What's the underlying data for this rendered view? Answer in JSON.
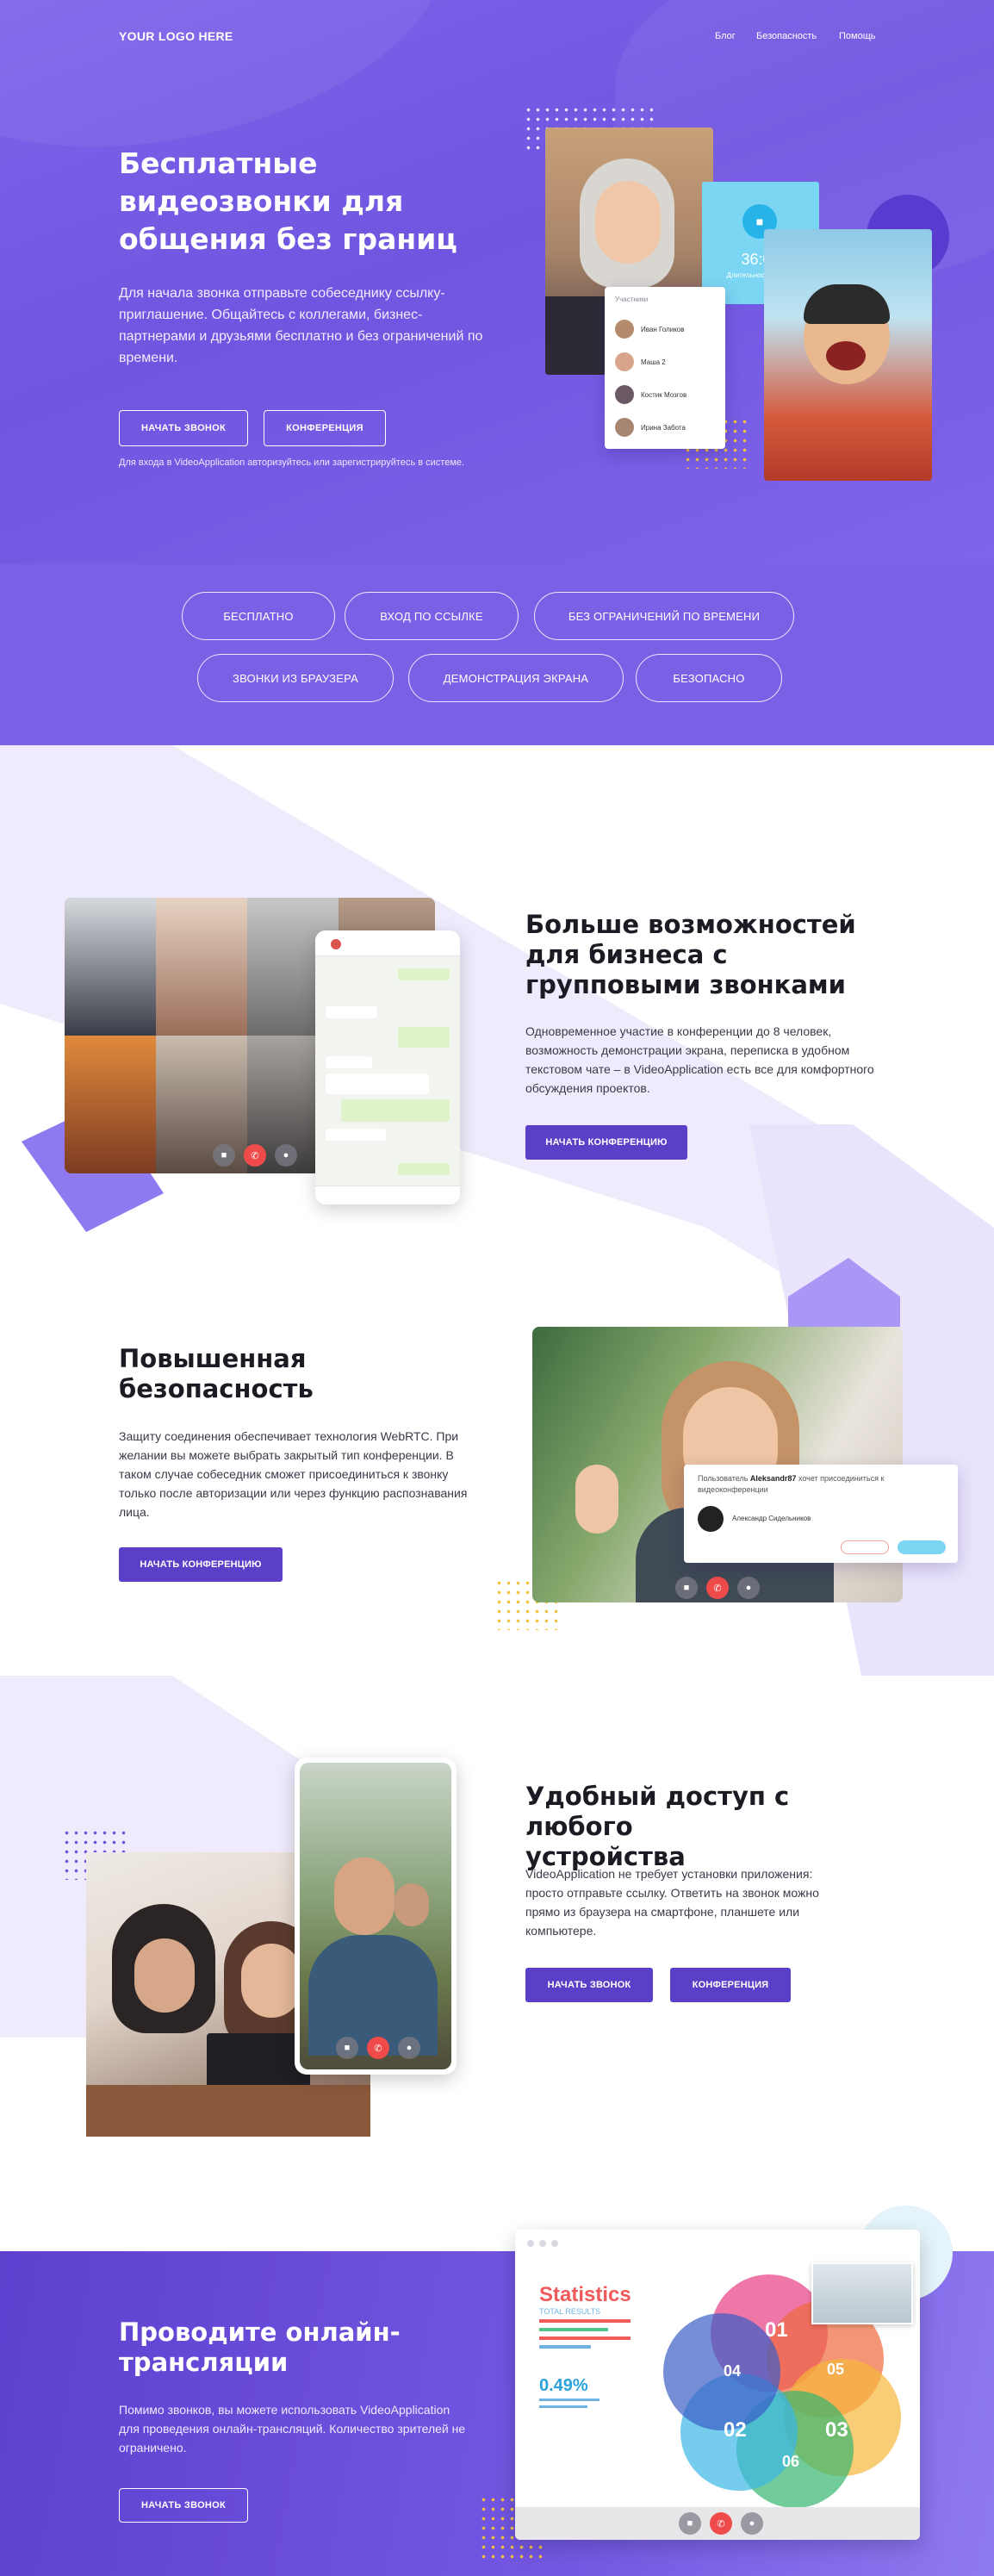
{
  "header": {
    "logo": "YOUR LOGO HERE",
    "nav": [
      "Блог",
      "Безопасность",
      "Помощь"
    ]
  },
  "hero": {
    "title": "Бесплатные видеозвонки для общения без границ",
    "lead": "Для начала звонка отправьте собеседнику ссылку-приглашение. Общайтесь с коллегами, бизнес-партнерами и друзьями бесплатно и без ограничений по времени.",
    "btn_call": "НАЧАТЬ ЗВОНОК",
    "btn_conf": "КОНФЕРЕНЦИЯ",
    "note": "Для входа в VideoApplication авторизуйтесь или зарегистрируйтесь в системе.",
    "timer": "36:05",
    "timer_label": "Длительность звонка",
    "participants_title": "Участники",
    "participants": [
      "Иван Голиков",
      "Маша 2",
      "Костик Мозгов",
      "Ирина Забота"
    ]
  },
  "features": [
    "БЕСПЛАТНО",
    "ВХОД ПО ССЫЛКЕ",
    "БЕЗ ОГРАНИЧЕНИЙ ПО ВРЕМЕНИ",
    "ЗВОНКИ ИЗ БРАУЗЕРА",
    "ДЕМОНСТРАЦИЯ ЭКРАНА",
    "БЕЗОПАСНО"
  ],
  "business": {
    "title": "Больше возможностей для бизнеса с групповыми звонками",
    "text": "Одновременное участие в конференции до 8 человек, возможность демонстрации экрана, переписка в удобном текстовом чате – в VideoApplication есть все для комфортного обсуждения проектов.",
    "btn": "НАЧАТЬ КОНФЕРЕНЦИЮ"
  },
  "security": {
    "title": "Повышенная безопасность",
    "text": "Защиту соединения обеспечивает технология WebRTC. При желании вы можете выбрать закрытый тип конференции. В таком случае собеседник сможет присоединиться к звонку только после авторизации или через функцию распознавания лица.",
    "btn": "НАЧАТЬ КОНФЕРЕНЦИЮ",
    "request_prefix": "Пользователь ",
    "request_user": "Aleksandr87",
    "request_suffix": " хочет присоединиться к видеоконференции",
    "request_name": "Александр Сидельников"
  },
  "access": {
    "title": "Удобный доступ с любого устройства",
    "text": "VideoApplication не требует установки приложения: просто отправьте ссылку. Ответить на звонок можно прямо из браузера на смартфоне, планшете или компьютере.",
    "btn_call": "НАЧАТЬ ЗВОНОК",
    "btn_conf": "КОНФЕРЕНЦИЯ"
  },
  "stream": {
    "title": "Проводите онлайн-трансляции",
    "text": "Помимо звонков, вы можете использовать VideoApplication для проведения онлайн-трансляций. Количество зрителей не ограничено.",
    "btn": "НАЧАТЬ ЗВОНОК",
    "stats_title": "Statistics",
    "stats_sub": "TOTAL RESULTS",
    "stats_pct": "0.49%",
    "venn": [
      "01",
      "02",
      "03",
      "04",
      "05",
      "06"
    ]
  },
  "colors": {
    "accent": "#5b3fc7",
    "hero": "#7b60e6",
    "light": "#efebfd",
    "cyan": "#6fd3f4",
    "red": "#f04b4b",
    "dots": "#f3c43a"
  }
}
